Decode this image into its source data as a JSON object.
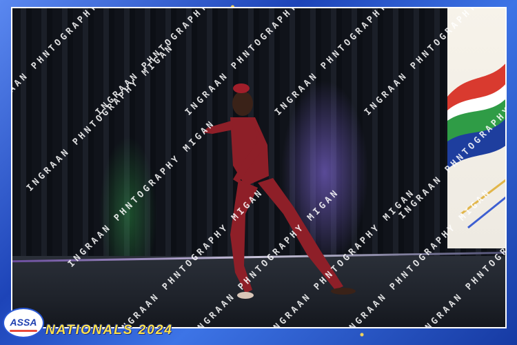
{
  "scene": {
    "description_icon": "dancer-photo",
    "performer_costume_color": "#8e1f28",
    "curtain_color": "#12151c",
    "stage_light_colors": [
      "#8e78ff",
      "#3cc85a"
    ]
  },
  "watermark": {
    "text": "INGRAAN PHNTOGRAPHY MIGAN"
  },
  "branding": {
    "logo_text": "ASSA",
    "event_title": "NATIONALS 2024",
    "title_color": "#ffe24a",
    "frame_color": "#1d44b8"
  }
}
